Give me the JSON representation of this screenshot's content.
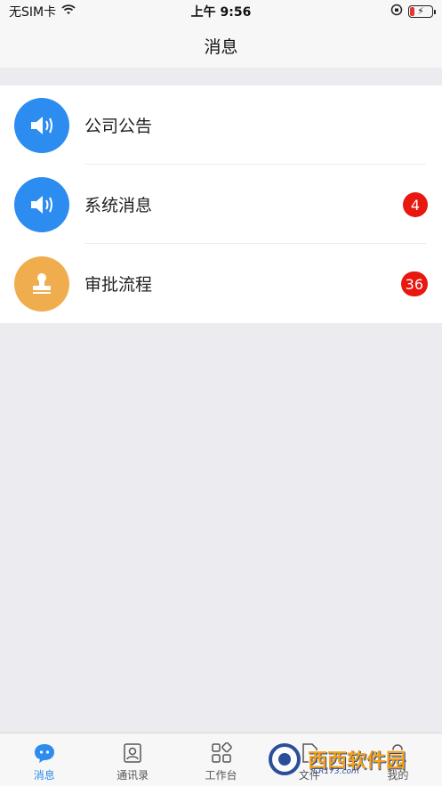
{
  "status_bar": {
    "carrier": "无SIM卡",
    "time": "上午 9:56"
  },
  "nav": {
    "title": "消息"
  },
  "messages": [
    {
      "label": "公司公告",
      "icon": "speaker-icon",
      "color": "#2d8cf0",
      "badge": ""
    },
    {
      "label": "系统消息",
      "icon": "speaker-icon",
      "color": "#2d8cf0",
      "badge": "4"
    },
    {
      "label": "审批流程",
      "icon": "stamp-icon",
      "color": "#f0ad4e",
      "badge": "36"
    }
  ],
  "tabs": [
    {
      "label": "消息",
      "icon": "chat-bubble-icon",
      "active": true
    },
    {
      "label": "通讯录",
      "icon": "contacts-icon",
      "active": false
    },
    {
      "label": "工作台",
      "icon": "workbench-icon",
      "active": false
    },
    {
      "label": "文件",
      "icon": "file-icon",
      "active": false
    },
    {
      "label": "我的",
      "icon": "profile-icon",
      "active": false
    }
  ],
  "colors": {
    "accent": "#2d8cf0",
    "badge": "#e8170f",
    "approval": "#f0ad4e"
  }
}
